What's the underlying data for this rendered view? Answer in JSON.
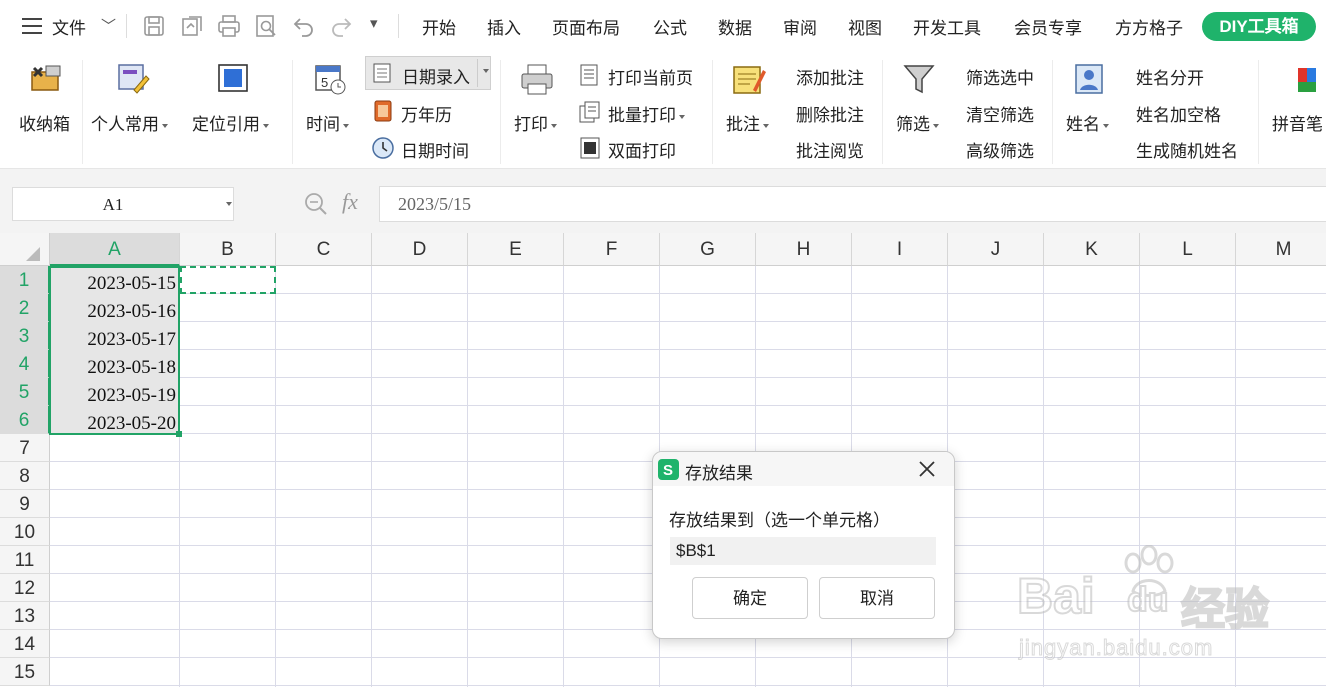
{
  "menubar": {
    "file_label": "文件",
    "tabs": [
      "开始",
      "插入",
      "页面布局",
      "公式",
      "数据",
      "审阅",
      "视图",
      "开发工具",
      "会员专享",
      "方方格子"
    ],
    "active_tab": "DIY工具箱"
  },
  "ribbon": {
    "toolbox": "收纳箱",
    "personal": "个人常用",
    "locate_ref": "定位引用",
    "time": "时间",
    "date_entry": "日期录入",
    "calendar": "万年历",
    "datetime": "日期时间",
    "print": "打印",
    "print_current": "打印当前页",
    "batch_print": "批量打印",
    "duplex_print": "双面打印",
    "comment": "批注",
    "add_comment": "添加批注",
    "delete_comment": "删除批注",
    "read_comment": "批注阅览",
    "filter": "筛选",
    "filter_selected": "筛选选中",
    "clear_filter": "清空筛选",
    "advanced_filter": "高级筛选",
    "name": "姓名",
    "split_name": "姓名分开",
    "name_add_space": "姓名加空格",
    "random_name": "生成随机姓名",
    "pinyin": "拼音笔"
  },
  "formula_bar": {
    "name_box": "A1",
    "fx": "fx",
    "formula": "2023/5/15"
  },
  "grid": {
    "columns": [
      "A",
      "B",
      "C",
      "D",
      "E",
      "F",
      "G",
      "H",
      "I",
      "J",
      "K",
      "L",
      "M"
    ],
    "rows": [
      "1",
      "2",
      "3",
      "4",
      "5",
      "6",
      "7",
      "8",
      "9",
      "10",
      "11",
      "12",
      "13",
      "14",
      "15"
    ],
    "cells_a": [
      "2023-05-15",
      "2023-05-16",
      "2023-05-17",
      "2023-05-18",
      "2023-05-19",
      "2023-05-20"
    ]
  },
  "dialog": {
    "title": "存放结果",
    "prompt": "存放结果到（选一个单元格）",
    "input_value": "$B$1",
    "ok": "确定",
    "cancel": "取消"
  },
  "watermark": {
    "brand": "Bai",
    "brand2": "du",
    "brand_cn": "经验",
    "url": "jingyan.baidu.com"
  },
  "colors": {
    "accent_green": "#1fb36b",
    "selection_green": "#21a366"
  }
}
